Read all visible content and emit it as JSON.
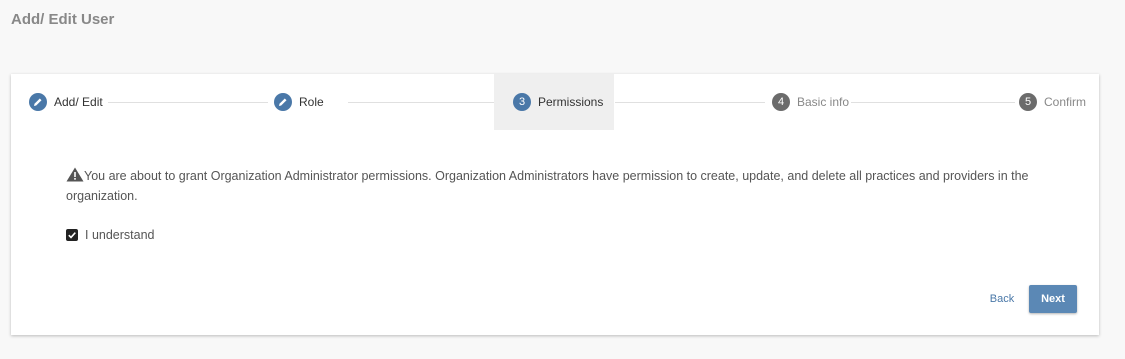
{
  "page": {
    "title": "Add/ Edit User"
  },
  "stepper": {
    "steps": [
      {
        "label": "Add/ Edit",
        "marker": "pencil",
        "state": "completed"
      },
      {
        "label": "Role",
        "marker": "pencil",
        "state": "completed"
      },
      {
        "label": "Permissions",
        "marker": "3",
        "state": "active"
      },
      {
        "label": "Basic info",
        "marker": "4",
        "state": "pending"
      },
      {
        "label": "Confirm",
        "marker": "5",
        "state": "pending"
      }
    ]
  },
  "warning": {
    "icon": "warning-triangle-icon",
    "text": "You are about to grant Organization Administrator permissions. Organization Administrators have permission to create, update, and delete all practices and providers in the organization."
  },
  "acknowledge": {
    "label": "I understand",
    "checked": true
  },
  "actions": {
    "back_label": "Back",
    "next_label": "Next"
  },
  "colors": {
    "primary": "#5b88b5",
    "step_active": "#4a78a8",
    "step_pending": "#6b6b6b"
  }
}
